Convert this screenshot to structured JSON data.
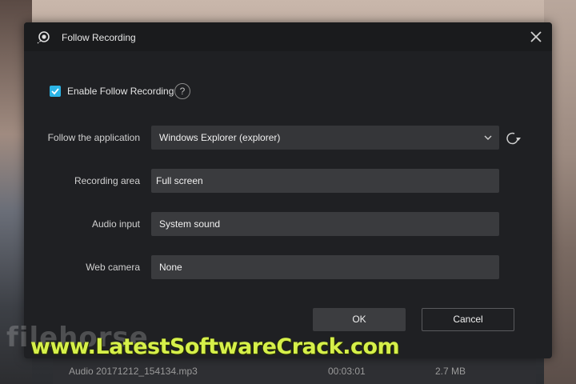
{
  "dialog": {
    "title": "Follow Recording",
    "enable_label": "Enable Follow Recording",
    "enable_checked": true,
    "help_glyph": "?",
    "fields": {
      "application": {
        "label": "Follow the application",
        "value": "Windows Explorer (explorer)"
      },
      "area": {
        "label": "Recording area",
        "value": "Full screen"
      },
      "audio": {
        "label": "Audio input",
        "value": "System sound"
      },
      "camera": {
        "label": "Web camera",
        "value": "None"
      }
    },
    "ok_label": "OK",
    "cancel_label": "Cancel",
    "icons": {
      "title": "record-target-icon",
      "close": "close-icon",
      "dropdown": "chevron-down-icon",
      "refresh": "refresh-icon",
      "help": "help-icon",
      "checkbox": "checkmark-icon"
    },
    "colors": {
      "accent": "#2bb4e6",
      "background": "#1f2023",
      "field": "#3a3b3e"
    }
  },
  "background_list": {
    "filename": "Audio 20171212_154134.mp3",
    "duration": "00:03:01",
    "size": "2.7 MB"
  },
  "watermark": {
    "text": "www.LatestSoftwareCrack.com",
    "faded_logo": "filehorse"
  }
}
